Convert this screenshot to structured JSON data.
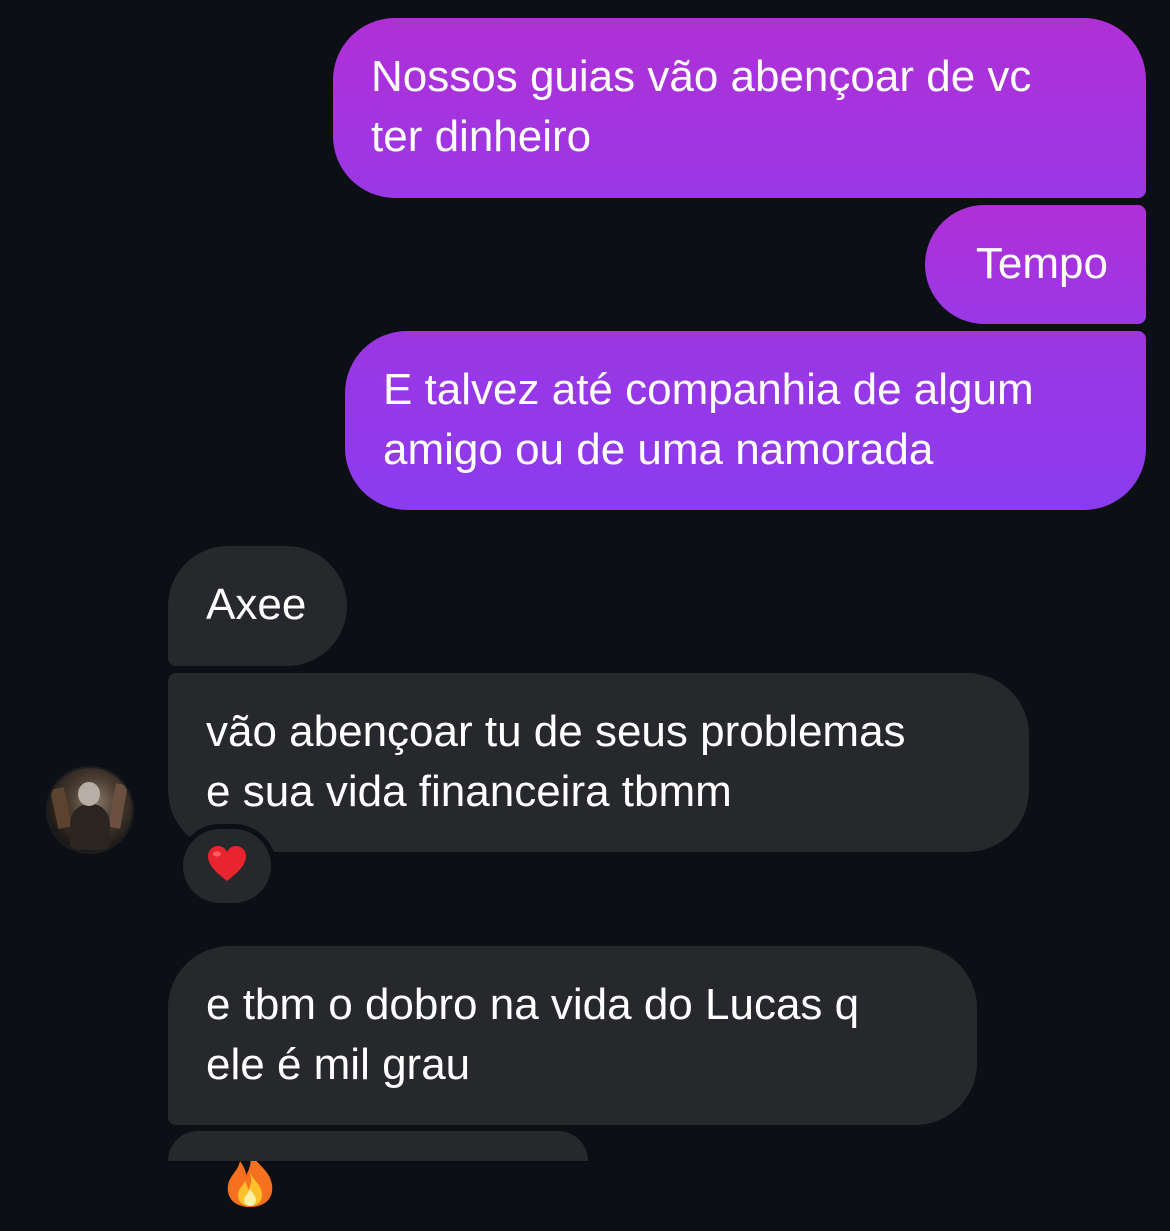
{
  "messages": {
    "outgoing": [
      {
        "text": "Nossos guias vão abençoar de vc\nter dinheiro"
      },
      {
        "text": "Tempo"
      },
      {
        "text": "E talvez até companhia de algum\namigo ou de uma namorada"
      }
    ],
    "incoming": [
      {
        "text": "Axee"
      },
      {
        "text": "vão abençoar tu de seus problemas\ne sua vida financeira tbmm",
        "reaction": "heart-emoji"
      },
      {
        "text": "e tbm o dobro na vida do Lucas q\nele é mil grau",
        "emoji": "fire-emoji"
      }
    ]
  },
  "colors": {
    "background": "#0c1014",
    "outgoing_top": "#b02fd6",
    "outgoing_bottom": "#8b3cf0",
    "incoming": "#26282c",
    "text": "#ffffff",
    "heart": "#e8242f"
  }
}
